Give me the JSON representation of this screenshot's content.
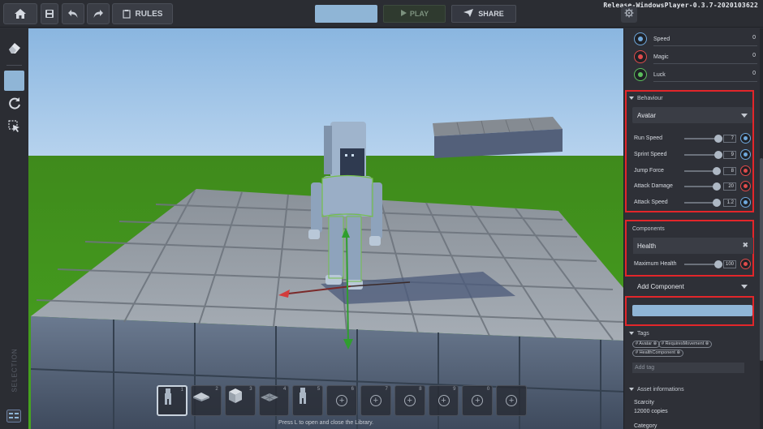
{
  "app": {
    "version": "Release-WindowsPlayer-0.3.7-2020103622"
  },
  "topbar": {
    "home_icon": "home-icon",
    "save_icon": "save-icon",
    "undo_icon": "undo-icon",
    "redo_icon": "redo-icon",
    "rules_label": "RULES",
    "name_value": "",
    "play_label": "PLAY",
    "share_label": "SHARE",
    "settings_icon": "gear-icon"
  },
  "leftbar": {
    "tools": [
      "eraser-icon",
      "select-square-icon",
      "refresh-icon",
      "selection-cursor-icon"
    ],
    "vertical_label": "SELECTION"
  },
  "library": {
    "slots": [
      {
        "num": "1",
        "kind": "avatar",
        "selected": true
      },
      {
        "num": "2",
        "kind": "plate"
      },
      {
        "num": "3",
        "kind": "cube"
      },
      {
        "num": "4",
        "kind": "floor"
      },
      {
        "num": "5",
        "kind": "avatar"
      },
      {
        "num": "6",
        "kind": "add"
      },
      {
        "num": "7",
        "kind": "add"
      },
      {
        "num": "8",
        "kind": "add"
      },
      {
        "num": "9",
        "kind": "add"
      },
      {
        "num": "0",
        "kind": "add"
      },
      {
        "num": "",
        "kind": "add"
      }
    ],
    "hint": "Press L to open and close the Library."
  },
  "panel": {
    "stats": [
      {
        "label": "Speed",
        "value": "0",
        "icon": "speed-icon",
        "color": "#6fa8dc"
      },
      {
        "label": "Magic",
        "value": "0",
        "icon": "magic-icon",
        "color": "#e04b4b"
      },
      {
        "label": "Luck",
        "value": "0",
        "icon": "clover-icon",
        "color": "#5cbf5c"
      }
    ],
    "behaviour": {
      "title": "Behaviour",
      "dropdown": "Avatar",
      "sliders": [
        {
          "label": "Run Speed",
          "value": "7",
          "fraction": 0.95,
          "icon_color": "#6fa8dc"
        },
        {
          "label": "Sprint Speed",
          "value": "9",
          "fraction": 0.95,
          "icon_color": "#6fa8dc"
        },
        {
          "label": "Jump Force",
          "value": "8",
          "fraction": 0.92,
          "icon_color": "#e04b4b"
        },
        {
          "label": "Attack Damage",
          "value": "20",
          "fraction": 0.92,
          "icon_color": "#e04b4b"
        },
        {
          "label": "Attack Speed",
          "value": "1.2",
          "fraction": 0.92,
          "icon_color": "#6fa8dc"
        }
      ]
    },
    "components": {
      "title": "Components",
      "header": "Health",
      "close_icon": "close-icon",
      "slider": {
        "label": "Maximum Health",
        "value": "100",
        "fraction": 0.95,
        "icon_color": "#e04b4b"
      }
    },
    "add_component": {
      "label": "Add Component"
    },
    "tags": {
      "title": "Tags",
      "items": [
        "# Avatar",
        "# RequiresMovement",
        "# HealthComponent"
      ],
      "placeholder": "Add tag"
    },
    "asset": {
      "title": "Asset informations",
      "scarcity_label": "Scarcity",
      "scarcity_value": "12000 copies",
      "category_label": "Category"
    }
  }
}
